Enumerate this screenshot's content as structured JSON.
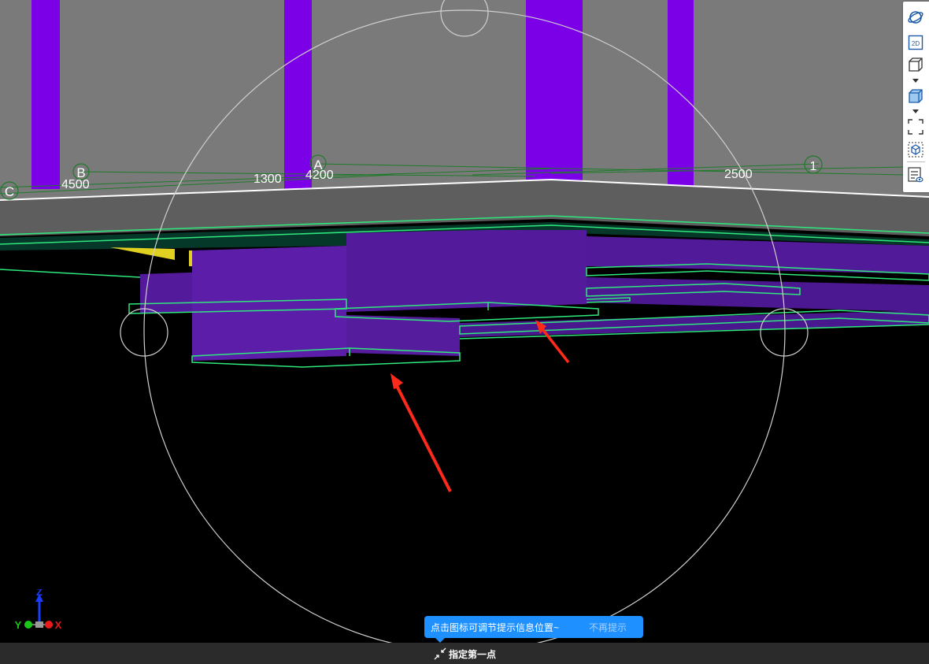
{
  "grid": {
    "axis_labels": [
      "C",
      "B",
      "A",
      "1"
    ],
    "dimensions": [
      "4500",
      "1300",
      "4200",
      "2500"
    ]
  },
  "tooltip": {
    "message": "点击图标可调节提示信息位置~",
    "dismiss": "不再提示"
  },
  "status": {
    "prompt": "指定第一点"
  },
  "triad": {
    "x": "X",
    "y": "Y",
    "z": "Z"
  },
  "toolbar": {
    "items": [
      "orbit-icon",
      "2d-view-icon",
      "wireframe-cube-icon",
      "shaded-cube-icon",
      "fullscreen-icon",
      "component-view-icon",
      "properties-panel-icon"
    ],
    "view2d_label": "2D"
  },
  "colors": {
    "background": "#000000",
    "wall": "#7a7a7a",
    "column": "#7b00e8",
    "beam": "#531a9c",
    "edge": "#2ee87c",
    "arrow": "#ff2a1a",
    "tooltip": "#1e90ff"
  }
}
